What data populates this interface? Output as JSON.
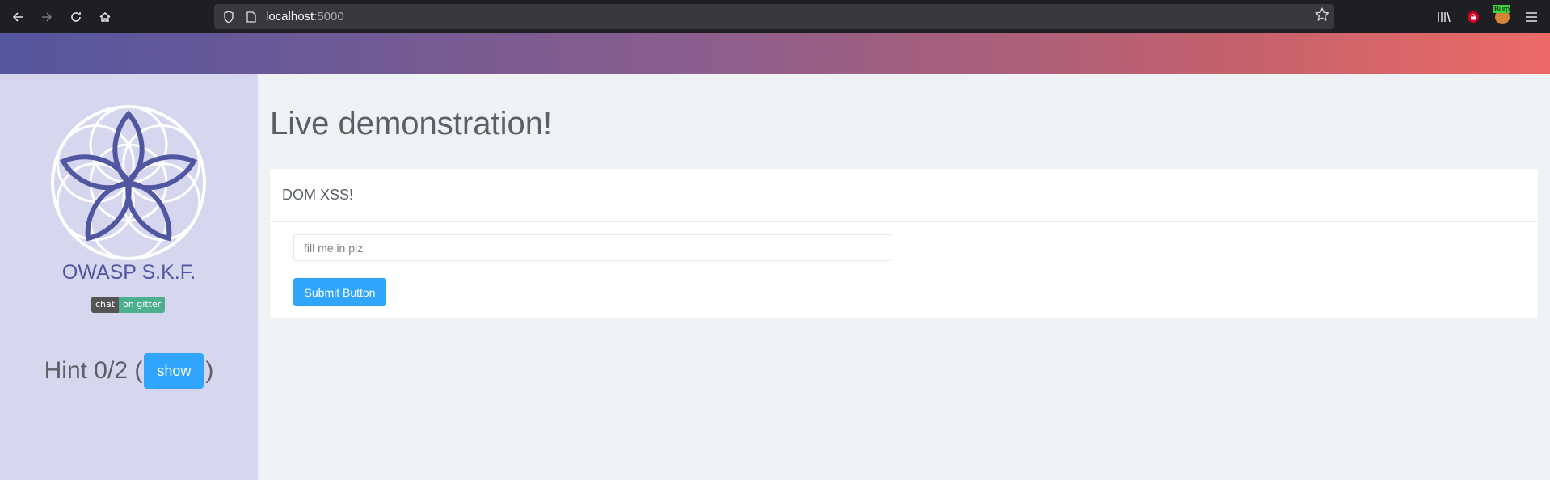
{
  "browser": {
    "url_host": "localhost",
    "url_port": ":5000",
    "icons": [
      "back-arrow-icon",
      "forward-arrow-icon",
      "reload-icon",
      "home-icon",
      "shield-icon",
      "page-icon",
      "star-icon",
      "library-icon",
      "red-lock-icon",
      "burp-icon",
      "menu-icon"
    ],
    "burp_label": "Burp"
  },
  "sidebar": {
    "brand": "OWASP S.K.F.",
    "badge_left": "chat",
    "badge_right": "on gitter",
    "hint_prefix": "Hint 0/2 (",
    "hint_button": "show",
    "hint_suffix": ")"
  },
  "main": {
    "title": "Live demonstration!",
    "card_title": "DOM XSS!",
    "input_placeholder": "fill me in plz",
    "submit_label": "Submit Button"
  },
  "colors": {
    "accent": "#31a4fb",
    "sidebar_bg": "#d6d6ee",
    "brand": "#5156a1"
  }
}
